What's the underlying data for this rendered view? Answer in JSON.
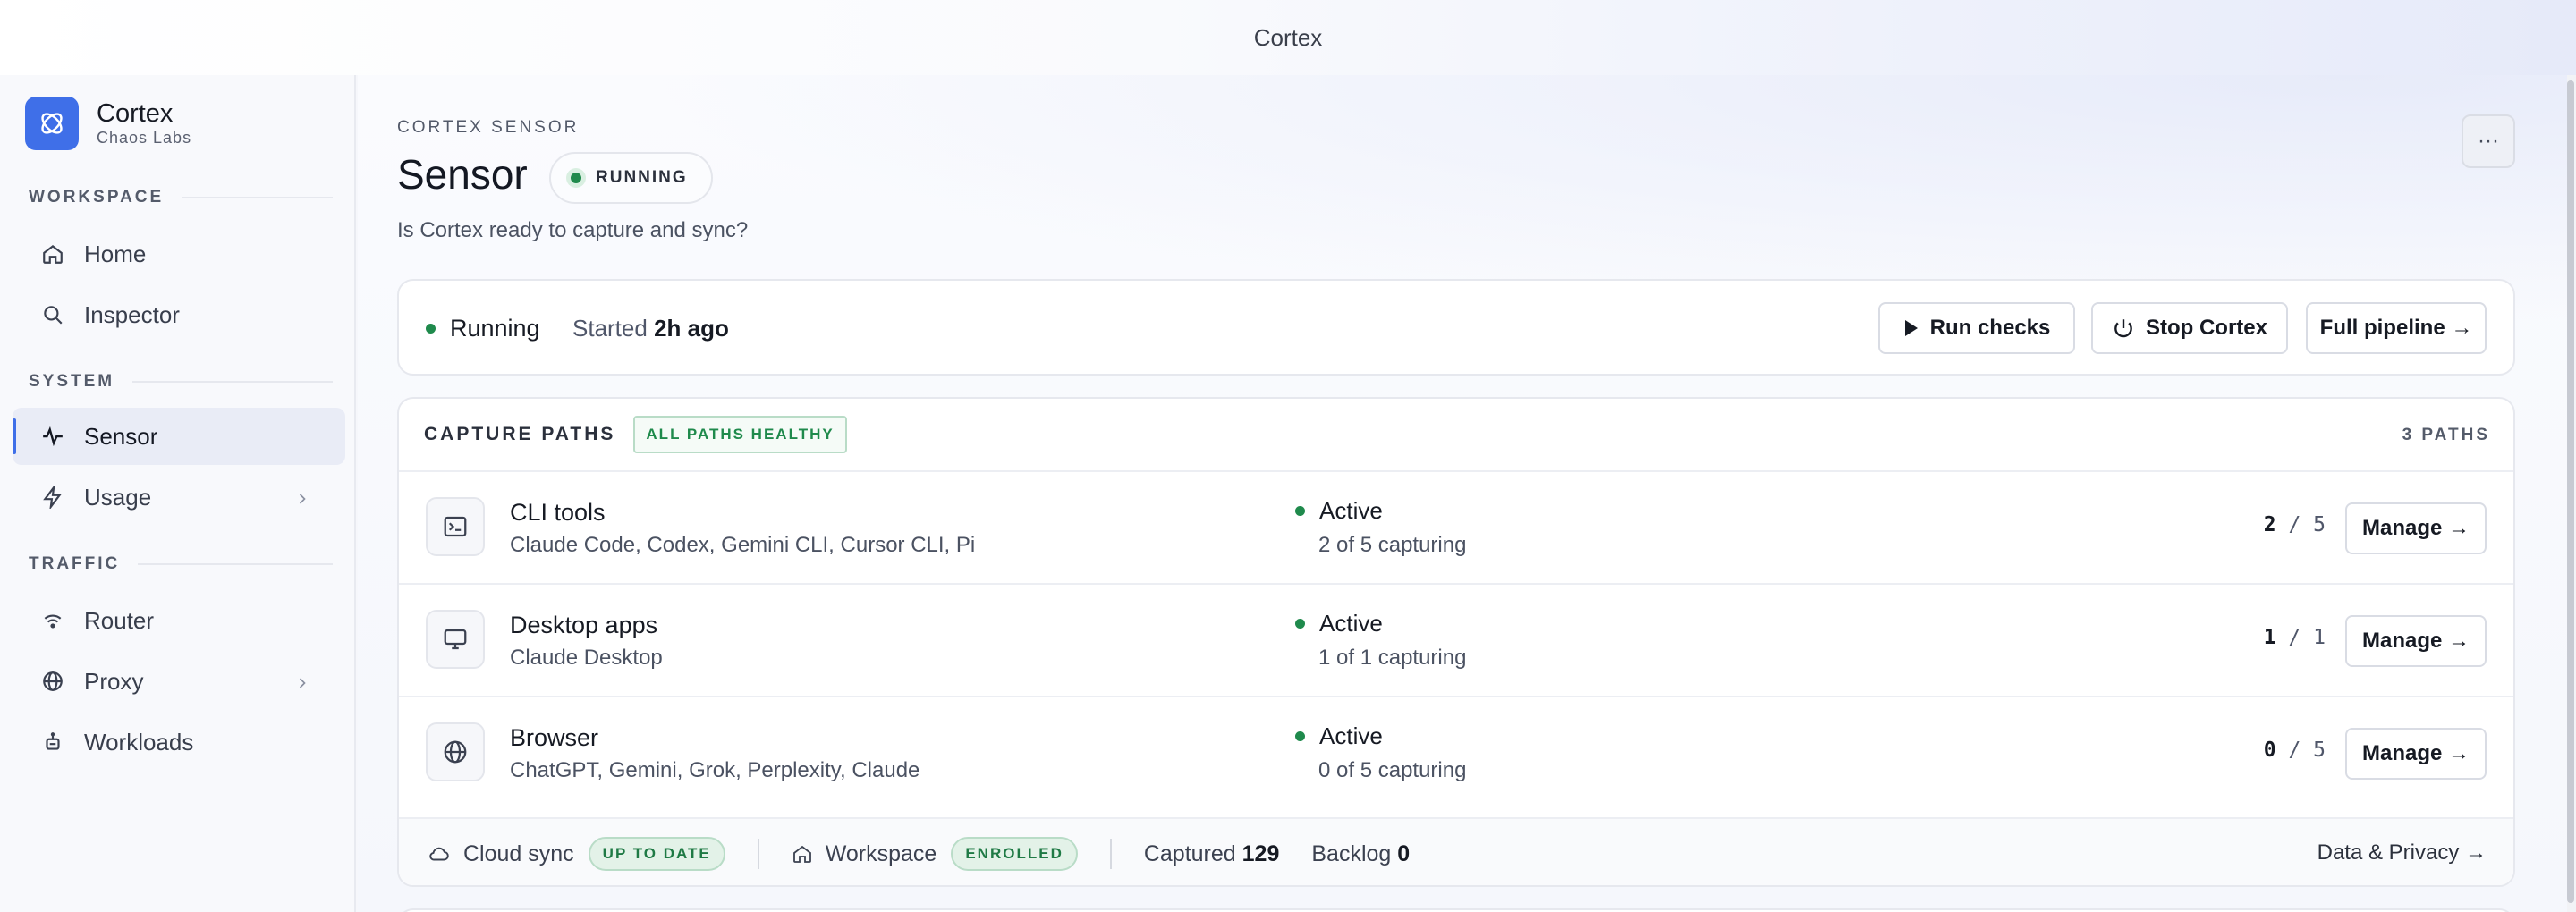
{
  "window": {
    "title": "Cortex"
  },
  "brand": {
    "name": "Cortex",
    "org": "Chaos Labs",
    "accent": "#3f6fe8"
  },
  "sidebar": {
    "sections": [
      {
        "label": "WORKSPACE"
      },
      {
        "label": "SYSTEM"
      },
      {
        "label": "TRAFFIC"
      }
    ],
    "items": [
      {
        "label": "Home",
        "icon": "home-icon"
      },
      {
        "label": "Inspector",
        "icon": "search-icon"
      },
      {
        "label": "Sensor",
        "icon": "activity-icon",
        "active": true
      },
      {
        "label": "Usage",
        "icon": "bolt-icon",
        "expandable": true
      },
      {
        "label": "Router",
        "icon": "wifi-icon"
      },
      {
        "label": "Proxy",
        "icon": "globe-icon",
        "expandable": true
      },
      {
        "label": "Workloads",
        "icon": "robot-icon"
      }
    ]
  },
  "header": {
    "kicker": "CORTEX SENSOR",
    "title": "Sensor",
    "status": "RUNNING",
    "subtitle": "Is Cortex ready to capture and sync?",
    "more_label": "···"
  },
  "status_card": {
    "state": "Running",
    "started_label": "Started",
    "started_value": "2h ago",
    "buttons": {
      "run_checks": "Run checks",
      "stop": "Stop Cortex",
      "pipeline": "Full pipeline →"
    }
  },
  "capture_paths": {
    "title": "CAPTURE PATHS",
    "badge": "ALL PATHS HEALTHY",
    "count": "3 PATHS",
    "rows": [
      {
        "name": "CLI tools",
        "desc": "Claude Code, Codex, Gemini CLI, Cursor CLI, Pi",
        "state": "Active",
        "sub": "2 of 5 capturing",
        "active": "2",
        "total": "/ 5",
        "action": "Manage →",
        "icon": "terminal-icon"
      },
      {
        "name": "Desktop apps",
        "desc": "Claude Desktop",
        "state": "Active",
        "sub": "1 of 1 capturing",
        "active": "1",
        "total": "/ 1",
        "action": "Manage →",
        "icon": "monitor-icon"
      },
      {
        "name": "Browser",
        "desc": "ChatGPT, Gemini, Grok, Perplexity, Claude",
        "state": "Active",
        "sub": "0 of 5 capturing",
        "active": "0",
        "total": "/ 5",
        "action": "Manage →",
        "icon": "globe-icon"
      }
    ],
    "footer": {
      "cloud_label": "Cloud sync",
      "cloud_badge": "UP TO DATE",
      "workspace_label": "Workspace",
      "workspace_badge": "ENROLLED",
      "captured_label": "Captured",
      "captured_value": "129",
      "backlog_label": "Backlog",
      "backlog_value": "0",
      "privacy_link": "Data & Privacy →"
    }
  },
  "colors": {
    "success": "#1f8a4c",
    "accent": "#3f6fe8"
  }
}
